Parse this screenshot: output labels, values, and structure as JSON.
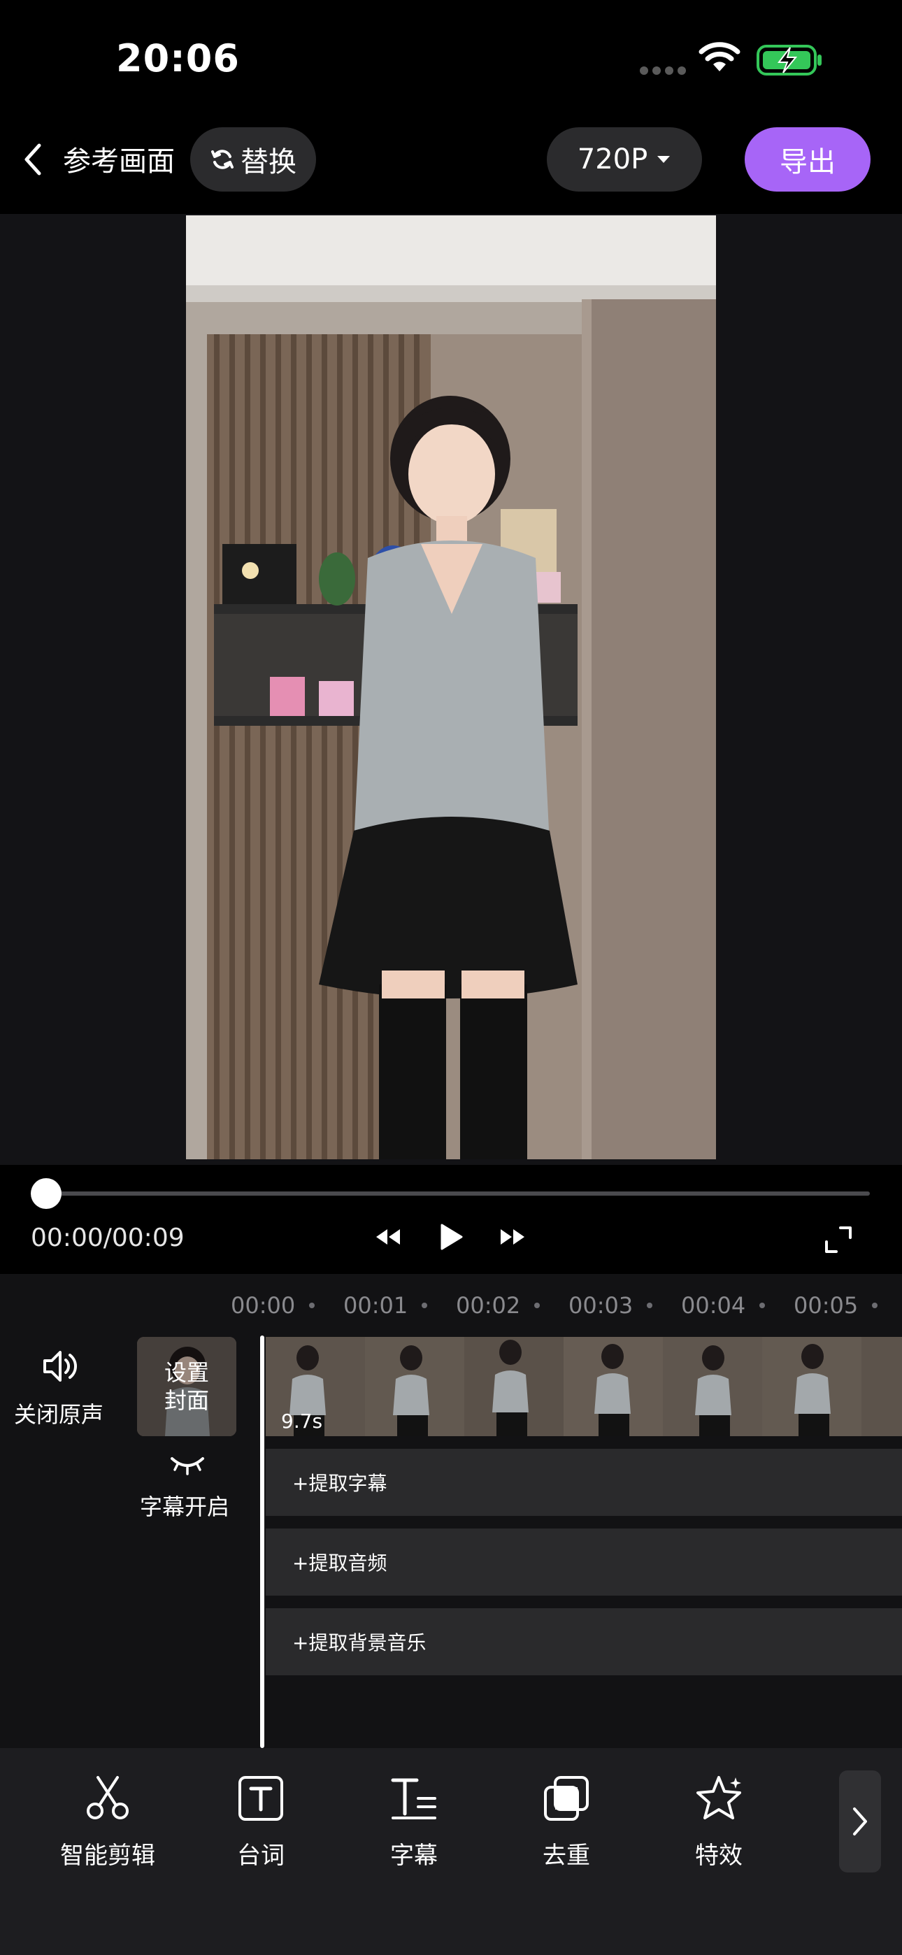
{
  "status_bar": {
    "time": "20:06"
  },
  "nav": {
    "back_icon": "chevron-left-icon",
    "title": "参考画面",
    "replace_label": "替换",
    "quality_label": "720P",
    "export_label": "导出"
  },
  "player": {
    "time_readout": "00:00/00:09",
    "progress": 0
  },
  "timeline": {
    "ruler": [
      "00:00",
      "00:01",
      "00:02",
      "00:03",
      "00:04",
      "00:05"
    ],
    "mute_label": "关闭原声",
    "cover_line1": "设置",
    "cover_line2": "封面",
    "subtitle_toggle_label": "字幕开启",
    "clip_duration": "9.7s",
    "tracks": [
      {
        "label": "+提取字幕"
      },
      {
        "label": "+提取音频"
      },
      {
        "label": "+提取背景音乐"
      }
    ]
  },
  "toolbar": {
    "items": [
      {
        "label": "智能剪辑",
        "icon": "scissors-icon"
      },
      {
        "label": "台词",
        "icon": "text-box-icon"
      },
      {
        "label": "字幕",
        "icon": "subtitle-icon"
      },
      {
        "label": "去重",
        "icon": "layers-icon"
      },
      {
        "label": "特效",
        "icon": "star-effect-icon"
      }
    ],
    "next_icon": "chevron-right-icon"
  },
  "colors": {
    "accent": "#a765f7",
    "background": "#000000",
    "panel": "#1d1d20",
    "track": "#2a2a2c",
    "battery": "#34c759"
  }
}
